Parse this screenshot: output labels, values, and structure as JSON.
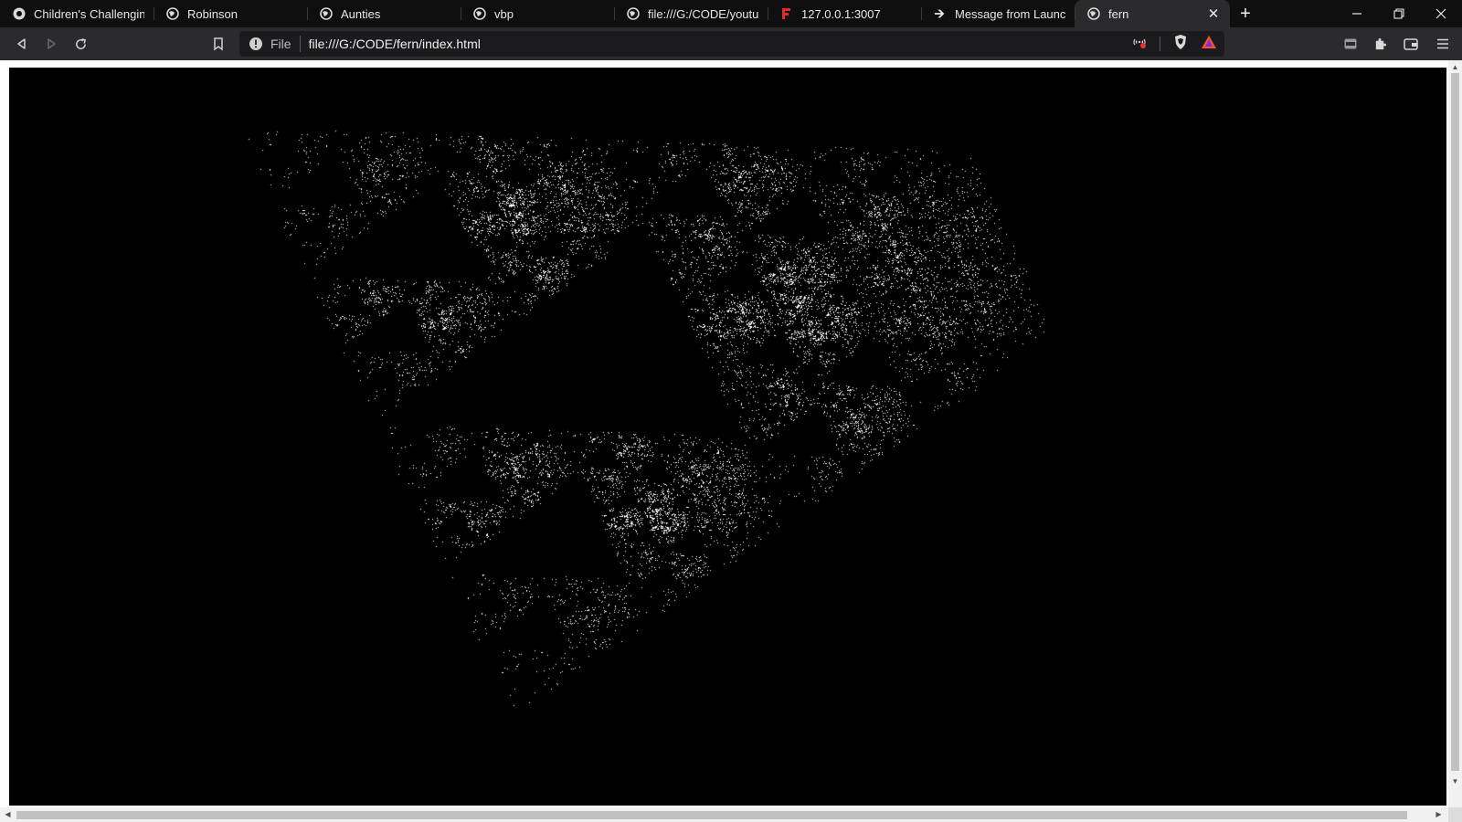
{
  "browser": {
    "tabs": [
      {
        "title": "Children's Challenging Be",
        "icon": "globe-icon"
      },
      {
        "title": "Robinson",
        "icon": "globe-icon"
      },
      {
        "title": "Aunties",
        "icon": "globe-icon"
      },
      {
        "title": "vbp",
        "icon": "globe-icon"
      },
      {
        "title": "file:///G:/CODE/youtubeg",
        "icon": "globe-icon"
      },
      {
        "title": "127.0.0.1:3007",
        "icon": "red-f-icon"
      },
      {
        "title": "Message from LaunchDar",
        "icon": "arrow-icon"
      },
      {
        "title": "fern",
        "icon": "globe-icon",
        "active": true
      }
    ],
    "new_tab_label": "+",
    "address": {
      "scheme_label": "File",
      "url": "file:///G:/CODE/fern/index.html"
    }
  },
  "page": {
    "background": "#000000",
    "point_color": "#ffffff",
    "content_description_tag": "chaos-game-fractal-points"
  },
  "colors": {
    "tabstrip_bg": "#0f0f10",
    "toolbar_bg": "#2b2b2e",
    "omnibox_bg": "#1b1b1d",
    "brave_accent": "#fb542b"
  }
}
